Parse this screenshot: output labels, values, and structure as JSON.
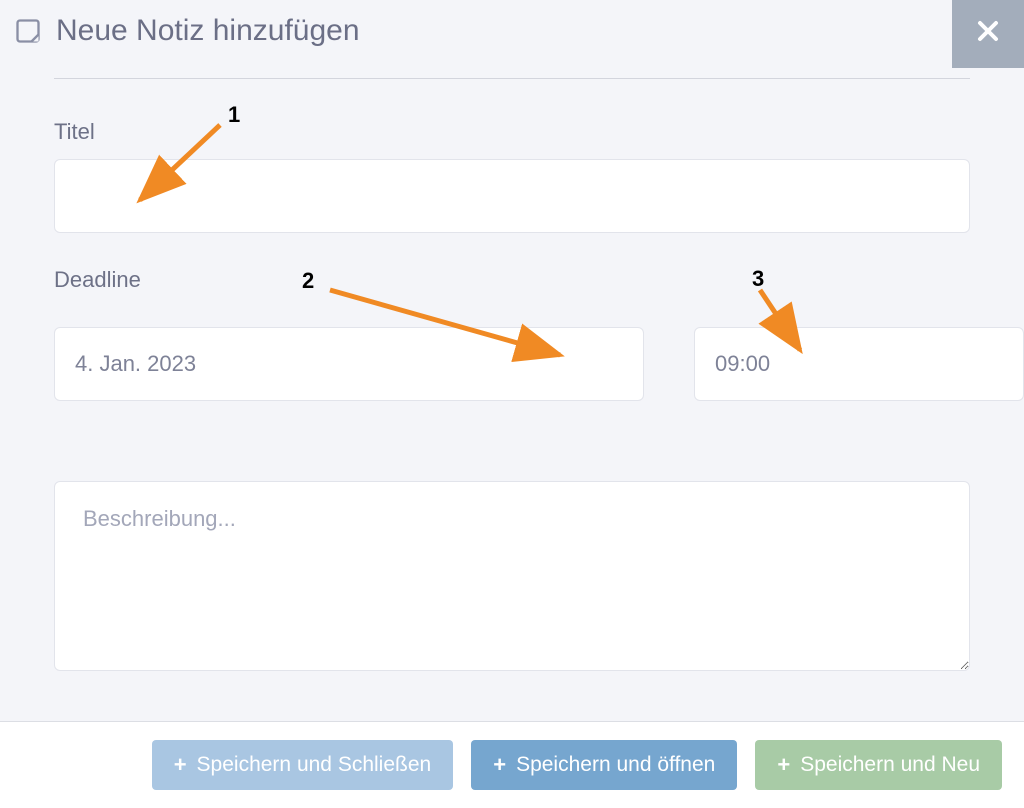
{
  "header": {
    "title": "Neue Notiz hinzufügen"
  },
  "fields": {
    "title_label": "Titel",
    "title_value": "",
    "deadline_label": "Deadline",
    "date_value": "4. Jan. 2023",
    "time_value": "09:00",
    "description_placeholder": "Beschreibung..."
  },
  "buttons": {
    "save_close": "Speichern und Schließen",
    "save_open": "Speichern und öffnen",
    "save_new": "Speichern und Neu"
  },
  "annotations": {
    "n1": "1",
    "n2": "2",
    "n3": "3"
  }
}
